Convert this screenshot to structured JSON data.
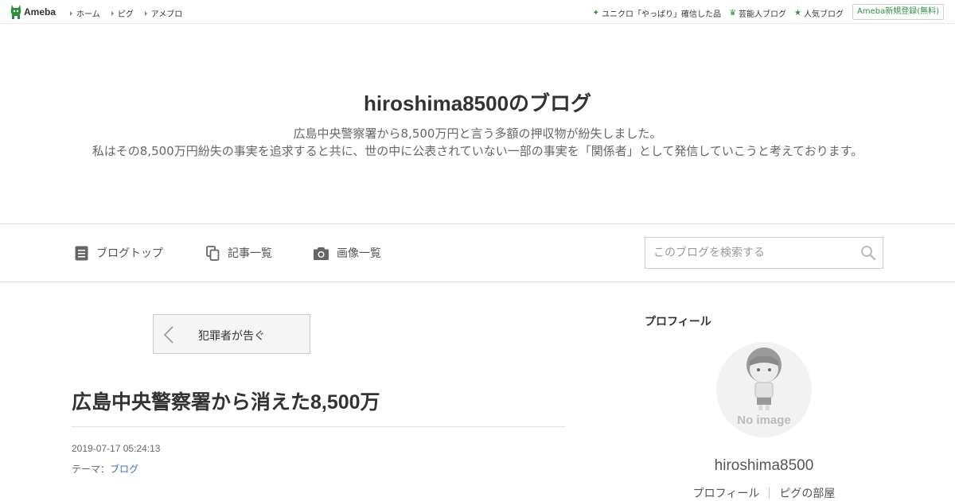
{
  "global_bar": {
    "logo": "Ameba",
    "nav": [
      "ホーム",
      "ピグ",
      "アメブロ"
    ],
    "right_links": [
      {
        "label": "ユニクロ「やっぱり」確信した品",
        "icon": "sparkle-icon"
      },
      {
        "label": "芸能人ブログ",
        "icon": "crown-icon"
      },
      {
        "label": "人気ブログ",
        "icon": "star-icon"
      }
    ],
    "signup": "Ameba新規登録(無料)",
    "accent": "#2d8f3c"
  },
  "header": {
    "title": "hiroshima8500のブログ",
    "description_line1": "広島中央警察署から8,500万円と言う多額の押収物が紛失しました。",
    "description_line2": "私はその8,500万円紛失の事実を追求すると共に、世の中に公表されていない一部の事実を「関係者」として発信していこうと考えております。"
  },
  "blog_nav": {
    "items": [
      "ブログトップ",
      "記事一覧",
      "画像一覧"
    ],
    "search_placeholder": "このブログを検索する"
  },
  "entry": {
    "prev_label": "犯罪者が告ぐ",
    "title": "広島中央警察署から消えた8,500万",
    "date": "2019-07-17 05:24:13",
    "theme_prefix": "テーマ：",
    "theme": "ブログ"
  },
  "sidebar": {
    "heading": "プロフィール",
    "no_image": "No image",
    "name": "hiroshima8500",
    "links": [
      "プロフィール",
      "ピグの部屋"
    ]
  }
}
